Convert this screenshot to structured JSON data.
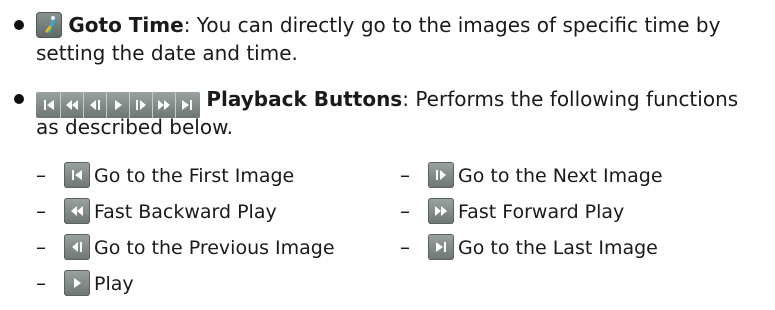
{
  "goto_item": {
    "icon": "goto-time-icon",
    "title": "Goto Time",
    "desc_line1": ": You can directly go to the images of specific time by",
    "desc_line2": "setting the date and time."
  },
  "playback_item": {
    "icon": "playback-buttons-strip-icon",
    "title": "Playback Buttons",
    "desc_line1": ": Performs the following functions",
    "desc_line2": "as described below."
  },
  "functions": [
    {
      "icon": "first-image-icon",
      "label": "Go to the First Image"
    },
    {
      "icon": "next-image-icon",
      "label": "Go to the Next Image"
    },
    {
      "icon": "fast-backward-icon",
      "label": "Fast Backward Play"
    },
    {
      "icon": "fast-forward-icon",
      "label": "Fast Forward Play"
    },
    {
      "icon": "previous-image-icon",
      "label": "Go to the Previous Image"
    },
    {
      "icon": "last-image-icon",
      "label": "Go to the Last Image"
    },
    {
      "icon": "play-icon",
      "label": "Play"
    }
  ],
  "dash": "–",
  "colors": {
    "button_bg": "#7f8886",
    "icon_fg": "#ffffff",
    "goto_accent": "#1aa0d6",
    "goto_accent2": "#f2b316"
  }
}
